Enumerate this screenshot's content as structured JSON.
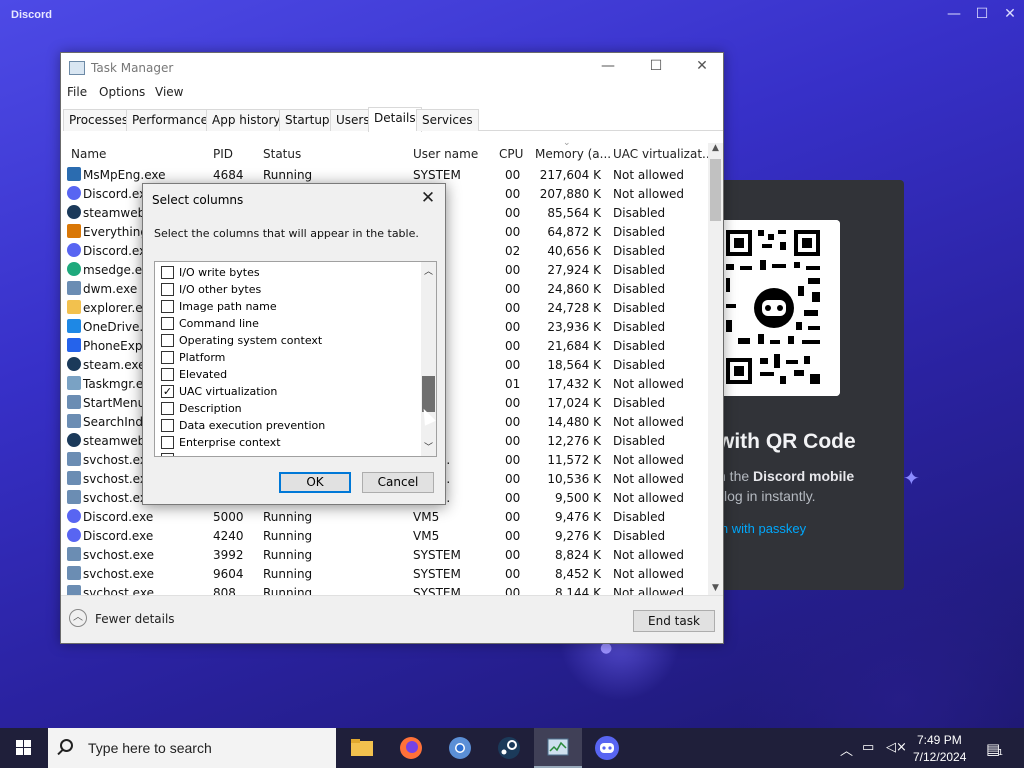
{
  "discord": {
    "title": "Discord",
    "qr_heading": "with QR Code",
    "qr_sub1_prefix": "h the ",
    "qr_sub1_bold": "Discord mobile",
    "qr_sub2": "log in instantly.",
    "passkey_link": "in with passkey"
  },
  "taskmanager": {
    "title": "Task Manager",
    "menu": [
      "File",
      "Options",
      "View"
    ],
    "tabs": [
      "Processes",
      "Performance",
      "App history",
      "Startup",
      "Users",
      "Details",
      "Services"
    ],
    "active_tab": "Details",
    "columns": [
      "Name",
      "PID",
      "Status",
      "User name",
      "CPU",
      "Memory (a...",
      "UAC virtualizat..."
    ],
    "rows": [
      {
        "name": "MsMpEng.exe",
        "pid": "4684",
        "status": "Running",
        "user": "SYSTEM",
        "cpu": "00",
        "mem": "217,604 K",
        "uac": "Not allowed",
        "icon": "defender-icon"
      },
      {
        "name": "Discord.exe",
        "pid": "",
        "status": "",
        "user": "",
        "cpu": "00",
        "mem": "207,880 K",
        "uac": "Not allowed",
        "icon": "discord-icon"
      },
      {
        "name": "steamwebh",
        "pid": "",
        "status": "",
        "user": "",
        "cpu": "00",
        "mem": "85,564 K",
        "uac": "Disabled",
        "icon": "steam-icon"
      },
      {
        "name": "Everything.",
        "pid": "",
        "status": "",
        "user": "",
        "cpu": "00",
        "mem": "64,872 K",
        "uac": "Disabled",
        "icon": "search-magnifier-icon"
      },
      {
        "name": "Discord.exe",
        "pid": "",
        "status": "",
        "user": "",
        "cpu": "02",
        "mem": "40,656 K",
        "uac": "Disabled",
        "icon": "discord-icon"
      },
      {
        "name": "msedge.exe",
        "pid": "",
        "status": "",
        "user": "",
        "cpu": "00",
        "mem": "27,924 K",
        "uac": "Disabled",
        "icon": "edge-icon"
      },
      {
        "name": "dwm.exe",
        "pid": "",
        "status": "",
        "user": "2",
        "cpu": "00",
        "mem": "24,860 K",
        "uac": "Disabled",
        "icon": "window-icon"
      },
      {
        "name": "explorer.exe",
        "pid": "",
        "status": "",
        "user": "",
        "cpu": "00",
        "mem": "24,728 K",
        "uac": "Disabled",
        "icon": "folder-icon"
      },
      {
        "name": "OneDrive.ex",
        "pid": "",
        "status": "",
        "user": "",
        "cpu": "00",
        "mem": "23,936 K",
        "uac": "Disabled",
        "icon": "cloud-icon"
      },
      {
        "name": "PhoneExpe",
        "pid": "",
        "status": "",
        "user": "",
        "cpu": "00",
        "mem": "21,684 K",
        "uac": "Disabled",
        "icon": "phone-icon"
      },
      {
        "name": "steam.exe",
        "pid": "",
        "status": "",
        "user": "",
        "cpu": "00",
        "mem": "18,564 K",
        "uac": "Disabled",
        "icon": "steam-icon"
      },
      {
        "name": "Taskmgr.ex",
        "pid": "",
        "status": "",
        "user": "",
        "cpu": "01",
        "mem": "17,432 K",
        "uac": "Not allowed",
        "icon": "taskmgr-icon"
      },
      {
        "name": "StartMenuE",
        "pid": "",
        "status": "",
        "user": "",
        "cpu": "00",
        "mem": "17,024 K",
        "uac": "Disabled",
        "icon": "window-icon"
      },
      {
        "name": "SearchInde",
        "pid": "",
        "status": "",
        "user": "M",
        "cpu": "00",
        "mem": "14,480 K",
        "uac": "Not allowed",
        "icon": "window-icon"
      },
      {
        "name": "steamwebh",
        "pid": "",
        "status": "",
        "user": "",
        "cpu": "00",
        "mem": "12,276 K",
        "uac": "Disabled",
        "icon": "steam-icon"
      },
      {
        "name": "svchost.exe",
        "pid": "",
        "status": "",
        "user": "L SE...",
        "cpu": "00",
        "mem": "11,572 K",
        "uac": "Not allowed",
        "icon": "window-icon"
      },
      {
        "name": "svchost.exe",
        "pid": "",
        "status": "",
        "user": "L SE...",
        "cpu": "00",
        "mem": "10,536 K",
        "uac": "Not allowed",
        "icon": "window-icon"
      },
      {
        "name": "svchost.exe",
        "pid": "",
        "status": "",
        "user": "L SE...",
        "cpu": "00",
        "mem": "9,500 K",
        "uac": "Not allowed",
        "icon": "window-icon"
      },
      {
        "name": "Discord.exe",
        "pid": "5000",
        "status": "Running",
        "user": "VM5",
        "cpu": "00",
        "mem": "9,476 K",
        "uac": "Disabled",
        "icon": "discord-icon"
      },
      {
        "name": "Discord.exe",
        "pid": "4240",
        "status": "Running",
        "user": "VM5",
        "cpu": "00",
        "mem": "9,276 K",
        "uac": "Disabled",
        "icon": "discord-icon"
      },
      {
        "name": "svchost.exe",
        "pid": "3992",
        "status": "Running",
        "user": "SYSTEM",
        "cpu": "00",
        "mem": "8,824 K",
        "uac": "Not allowed",
        "icon": "window-icon"
      },
      {
        "name": "svchost.exe",
        "pid": "9604",
        "status": "Running",
        "user": "SYSTEM",
        "cpu": "00",
        "mem": "8,452 K",
        "uac": "Not allowed",
        "icon": "window-icon"
      },
      {
        "name": "svchost.exe",
        "pid": "808",
        "status": "Running",
        "user": "SYSTEM",
        "cpu": "00",
        "mem": "8,144 K",
        "uac": "Not allowed",
        "icon": "window-icon"
      }
    ],
    "fewer_details": "Fewer details",
    "end_task": "End task"
  },
  "dialog": {
    "title": "Select columns",
    "description": "Select the columns that will appear in the table.",
    "options": [
      {
        "label": "I/O write bytes",
        "checked": false
      },
      {
        "label": "I/O other bytes",
        "checked": false
      },
      {
        "label": "Image path name",
        "checked": false
      },
      {
        "label": "Command line",
        "checked": false
      },
      {
        "label": "Operating system context",
        "checked": false
      },
      {
        "label": "Platform",
        "checked": false
      },
      {
        "label": "Elevated",
        "checked": false
      },
      {
        "label": "UAC virtualization",
        "checked": true
      },
      {
        "label": "Description",
        "checked": false
      },
      {
        "label": "Data execution prevention",
        "checked": false
      },
      {
        "label": "Enterprise context",
        "checked": false
      }
    ],
    "ok": "OK",
    "cancel": "Cancel"
  },
  "taskbar": {
    "search_placeholder": "Type here to search",
    "apps": [
      "file-explorer-icon",
      "firefox-icon",
      "chromium-icon",
      "steam-icon",
      "task-manager-icon",
      "discord-icon"
    ],
    "active_app": "task-manager-icon",
    "time": "7:49 PM",
    "date": "7/12/2024",
    "notification_count": "1"
  },
  "colors": {
    "discord_blurple": "#5865f2",
    "discord_panel": "#313338",
    "taskbar": "#1f1f3a",
    "accent": "#0078d7",
    "link": "#00a8fc"
  }
}
